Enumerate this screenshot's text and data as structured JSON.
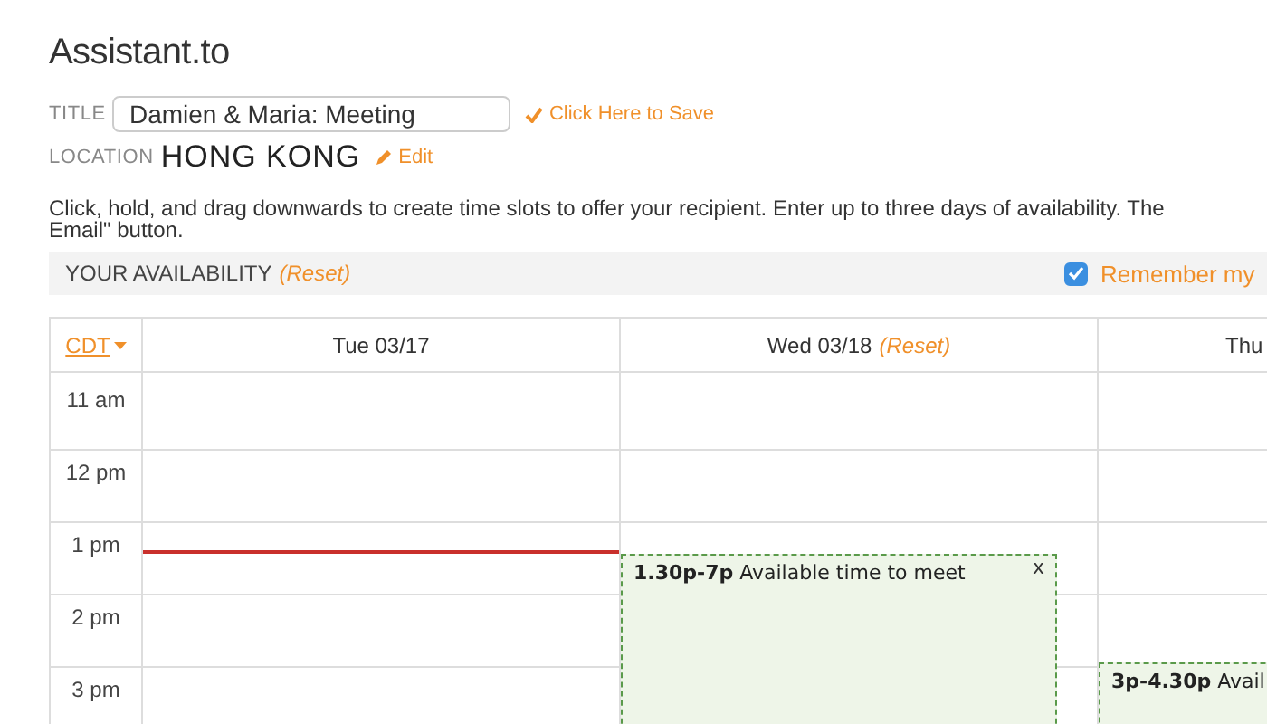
{
  "app": {
    "title": "Assistant.to"
  },
  "meeting": {
    "title_label": "TITLE",
    "title_value": "Damien & Maria: Meeting",
    "save_link": "Click Here to Save",
    "location_label": "LOCATION",
    "location_value": "HONG KONG",
    "edit_link": "Edit"
  },
  "instructions": [
    "Click, hold, and drag downwards to create time slots to offer your recipient. Enter up to three days of availability. The",
    "Email\" button."
  ],
  "availability_bar": {
    "label": "YOUR AVAILABILITY",
    "reset": "(Reset)",
    "remember": {
      "label": "Remember my",
      "checked": true
    }
  },
  "calendar": {
    "timezone": "CDT",
    "days": [
      {
        "label": "Tue 03/17",
        "now_line": true
      },
      {
        "label": "Wed 03/18",
        "reset": "(Reset)",
        "now_line": false,
        "events": [
          {
            "time": "1.30p-7p",
            "text": "Available time to meet",
            "close": "x"
          }
        ]
      },
      {
        "label": "Thu",
        "now_line": false,
        "events": [
          {
            "time": "3p-4.30p",
            "text": "Avail"
          }
        ]
      }
    ],
    "hours": [
      "11 am",
      "12 pm",
      "1 pm",
      "2 pm",
      "3 pm"
    ]
  }
}
